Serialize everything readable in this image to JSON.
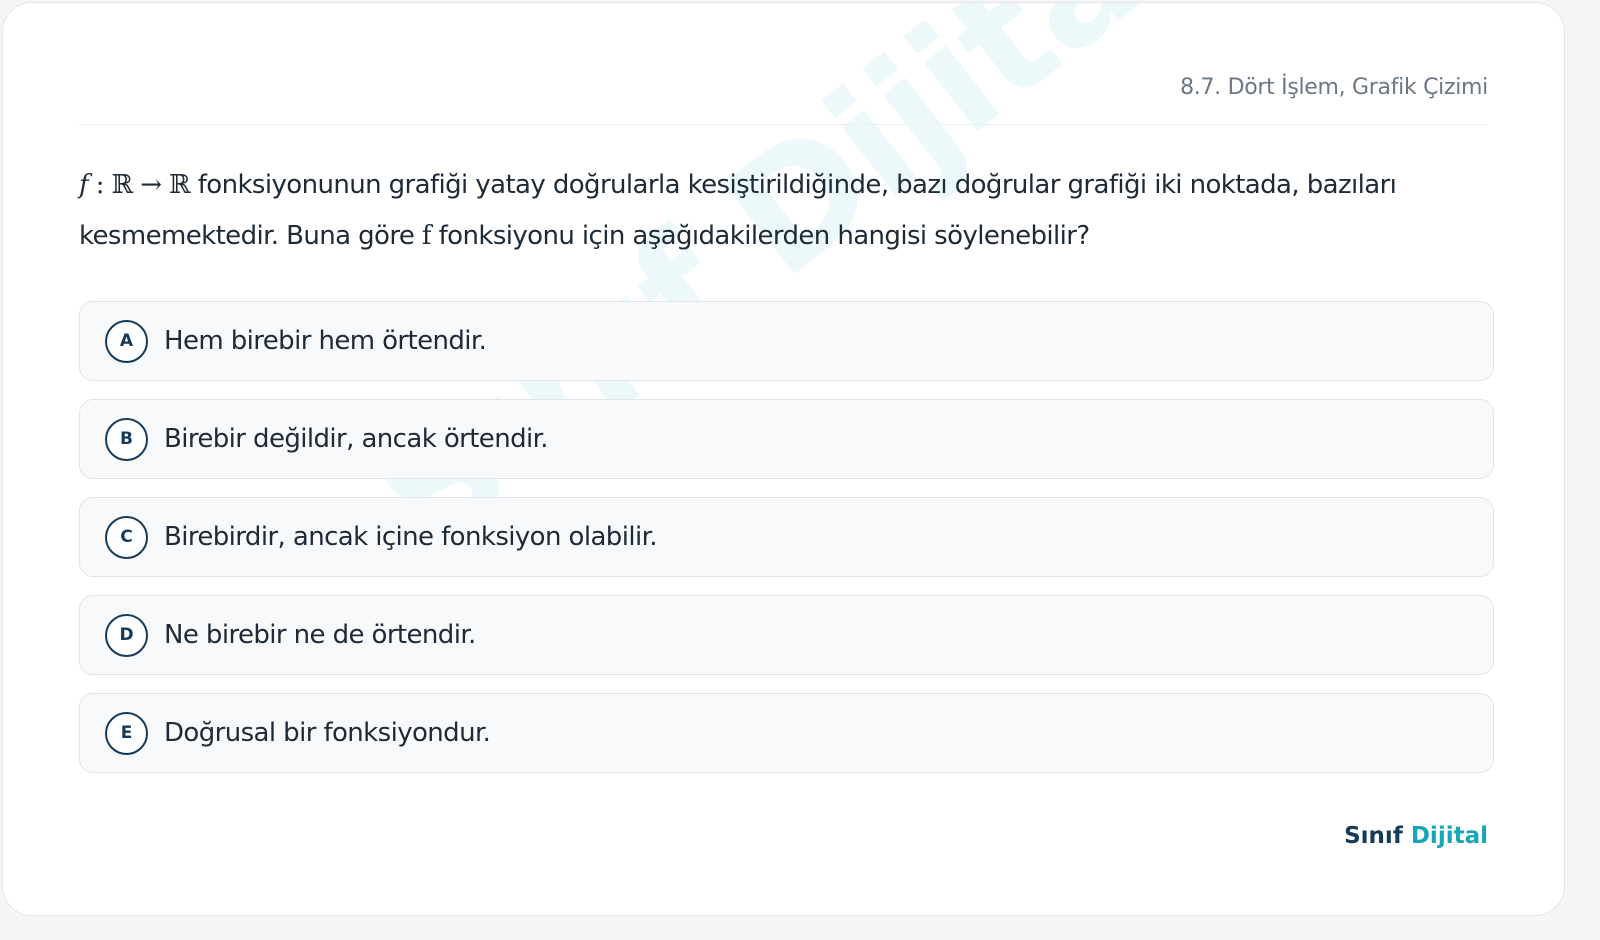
{
  "header": {
    "topic": "8.7. Dört İşlem, Grafik Çizimi"
  },
  "question": {
    "math_f": "f",
    "math_mapping": " : ℝ → ℝ",
    "text_1": " fonksiyonunun grafiği yatay doğrularla kesiştirildiğinde, bazı doğrular grafiği iki noktada, bazıları kesmemektedir. Buna göre ",
    "math_f2": "f",
    "text_2": " fonksiyonu için aşağıdakilerden hangisi söylenebilir?"
  },
  "options": [
    {
      "letter": "A",
      "text": "Hem birebir hem örtendir."
    },
    {
      "letter": "B",
      "text": "Birebir değildir, ancak örtendir."
    },
    {
      "letter": "C",
      "text": "Birebirdir, ancak içine fonksiyon olabilir."
    },
    {
      "letter": "D",
      "text": "Ne birebir ne de örtendir."
    },
    {
      "letter": "E",
      "text": "Doğrusal bir fonksiyondur."
    }
  ],
  "watermark": "Sınıf Dijital",
  "brand": {
    "part1": "Sınıf",
    "part2": "Dijital"
  },
  "colors": {
    "accent": "#17a6b4",
    "navy": "#153b5a"
  }
}
